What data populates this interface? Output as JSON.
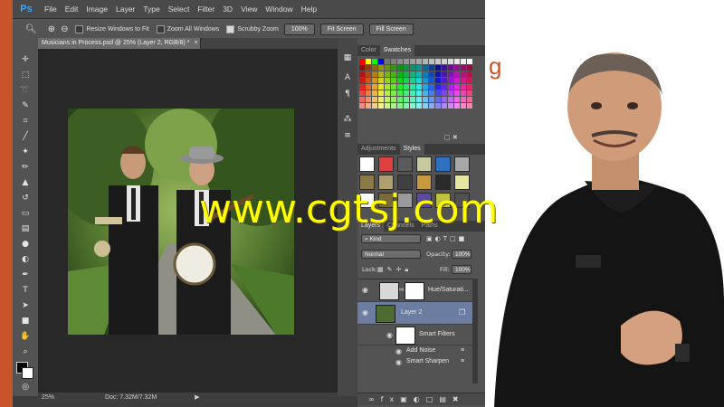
{
  "app": {
    "logo": "Ps"
  },
  "menu": [
    "File",
    "Edit",
    "Image",
    "Layer",
    "Type",
    "Select",
    "Filter",
    "3D",
    "View",
    "Window",
    "Help"
  ],
  "options_bar": {
    "resize_windows": "Resize Windows to Fit",
    "zoom_all": "Zoom All Windows",
    "scrubby_zoom": "Scrubby Zoom",
    "zoom_value": "100%",
    "fit_screen": "Fit Screen",
    "fill_screen": "Fill Screen"
  },
  "document": {
    "tab_title": "Musicians in Process.psd @ 25% (Layer 2, RGB/8) *"
  },
  "status_bar": {
    "zoom": "25%",
    "doc_size": "Doc: 7.32M/7.32M"
  },
  "panels": {
    "color_tabs": [
      "Color",
      "Swatches"
    ],
    "adjust_tabs": [
      "Adjustments",
      "Styles"
    ],
    "layer_tabs": [
      "Layers",
      "Channels",
      "Paths"
    ],
    "kind_filter": "Kind",
    "blend_mode": "Normal",
    "opacity_label": "Opacity:",
    "opacity_value": "100%",
    "lock_label": "Lock:",
    "fill_label": "Fill:",
    "fill_value": "100%",
    "layers": [
      {
        "name": "Hue/Saturati..."
      },
      {
        "name": "Layer 2"
      }
    ],
    "smart_filters_label": "Smart Filters",
    "filters": [
      "Add Noise",
      "Smart Sharpen"
    ]
  },
  "watermark": "www.cgtsj.com",
  "brand_fragment": "g",
  "colors": {
    "frame_accent": "#c9542a",
    "watermark": "#ffff00",
    "ps_blue": "#31a8ff"
  }
}
